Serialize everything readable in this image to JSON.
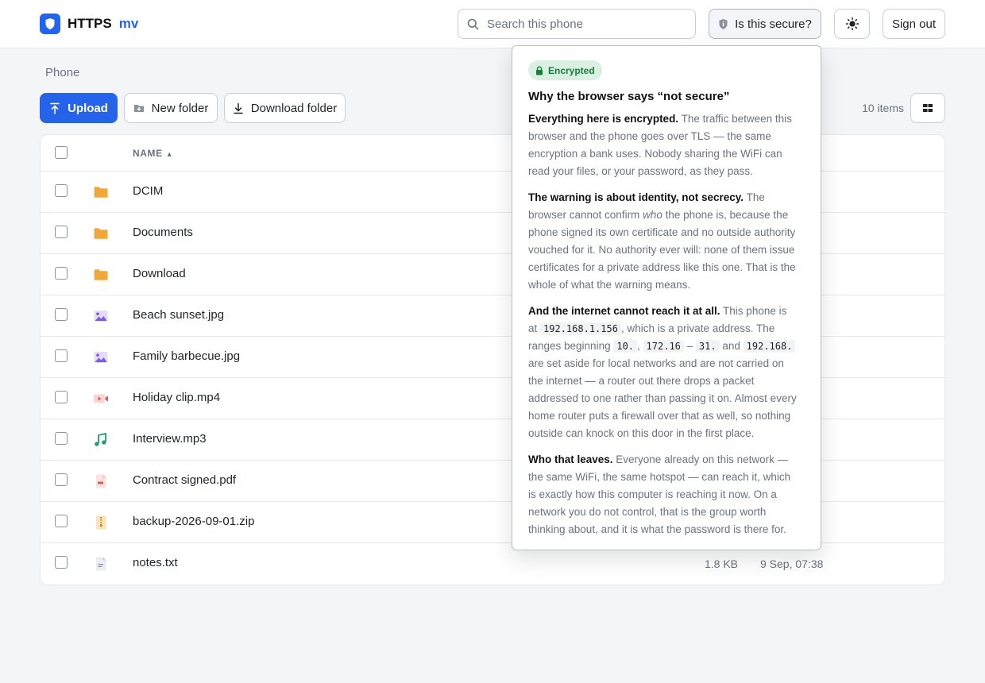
{
  "brand": {
    "name": "HTTPS",
    "sub": "mv",
    "accent": "#2563eb"
  },
  "search": {
    "placeholder": "Search this phone",
    "icon": "search-icon"
  },
  "header": {
    "secure_label": "Is this secure?",
    "theme_icon": "sun-icon",
    "signout_label": "Sign out"
  },
  "breadcrumb": "Phone",
  "toolbar": {
    "upload_label": "Upload",
    "new_folder_label": "New folder",
    "download_folder_label": "Download folder",
    "item_count": "10 items",
    "view_icon": "grid-view-icon"
  },
  "table": {
    "header_name": "NAME",
    "sort_indicator": "▲",
    "rows": [
      {
        "name": "DCIM",
        "icon": "folder-icon",
        "size": "",
        "date": ""
      },
      {
        "name": "Documents",
        "icon": "folder-icon",
        "size": "",
        "date": ""
      },
      {
        "name": "Download",
        "icon": "folder-icon",
        "size": "",
        "date": ""
      },
      {
        "name": "Beach sunset.jpg",
        "icon": "image-icon",
        "size": "",
        "date": ""
      },
      {
        "name": "Family barbecue.jpg",
        "icon": "image-icon",
        "size": "",
        "date": ""
      },
      {
        "name": "Holiday clip.mp4",
        "icon": "video-icon",
        "size": "",
        "date": ""
      },
      {
        "name": "Interview.mp3",
        "icon": "audio-icon",
        "size": "",
        "date": ""
      },
      {
        "name": "Contract signed.pdf",
        "icon": "pdf-icon",
        "size": "",
        "date": ""
      },
      {
        "name": "backup-2026-09-01.zip",
        "icon": "zip-icon",
        "size": "",
        "date": ""
      },
      {
        "name": "notes.txt",
        "icon": "text-file-icon",
        "size": "1.8 KB",
        "date": "9 Sep, 07:38"
      }
    ]
  },
  "popover": {
    "badge": "Encrypted",
    "title": "Why the browser says “not secure”",
    "p1_strong": "Everything here is encrypted.",
    "p1_text": " The traffic between this browser and the phone goes over TLS — the same encryption a bank uses. Nobody sharing the WiFi can read your files, or your password, as they pass.",
    "p2_strong": "The warning is about identity, not secrecy.",
    "p2_text_a": " The browser cannot confirm ",
    "p2_em": "who",
    "p2_text_b": " the phone is, because the phone signed its own certificate and no outside authority vouched for it. No authority ever will: none of them issue certificates for a private address like this one. That is the whole of what the warning means.",
    "p3_strong": "And the internet cannot reach it at all.",
    "p3_text_a": " This phone is at ",
    "p3_code_ip": "192.168.1.156",
    "p3_text_b": ", which is a private address. The ranges beginning ",
    "p3_code_10": "10.",
    "p3_sep": ", ",
    "p3_code_172a": "172.16",
    "p3_dash": " – ",
    "p3_code_172b": "31.",
    "p3_and": " and ",
    "p3_code_192": "192.168.",
    "p3_text_c": " are set aside for local networks and are not carried on the internet — a router out there drops a packet addressed to one rather than passing it on. Almost every home router puts a firewall over that as well, so nothing outside can knock on this door in the first place.",
    "p4_strong": "Who that leaves.",
    "p4_text": " Everyone already on this network — the same WiFi, the same hotspot — can reach it, which is exactly how this computer is reaching it now. On a network you do not control, that is the group worth thinking about, and it is what the password is there for."
  }
}
